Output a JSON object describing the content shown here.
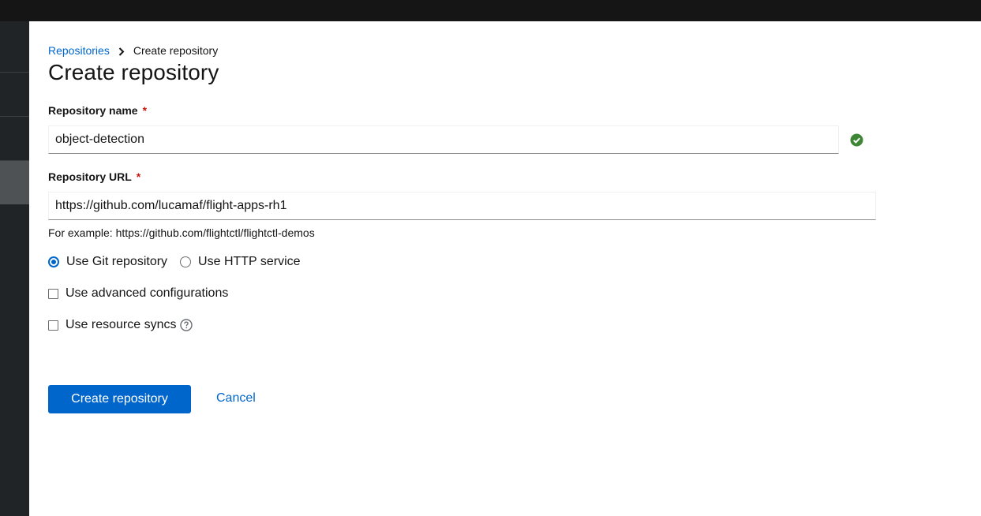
{
  "breadcrumb": {
    "parent": "Repositories",
    "current": "Create repository"
  },
  "page": {
    "title": "Create repository"
  },
  "form": {
    "name": {
      "label": "Repository name",
      "required_marker": "*",
      "value": "object-detection",
      "status": "valid"
    },
    "url": {
      "label": "Repository URL",
      "required_marker": "*",
      "value": "https://github.com/lucamaf/flight-apps-rh1",
      "helper": "For example: https://github.com/flightctl/flightctl-demos"
    },
    "repo_type": {
      "options": [
        "Use Git repository",
        "Use HTTP service"
      ],
      "selected": "Use Git repository"
    },
    "advanced": {
      "label": "Use advanced configurations",
      "checked": false
    },
    "resource_syncs": {
      "label": "Use resource syncs",
      "checked": false,
      "icon": "help-icon"
    }
  },
  "actions": {
    "submit": "Create repository",
    "cancel": "Cancel"
  },
  "colors": {
    "primary": "#0066cc",
    "success": "#3e8635",
    "required": "#c9190b",
    "masthead": "#151515",
    "sidebar": "#212427"
  }
}
